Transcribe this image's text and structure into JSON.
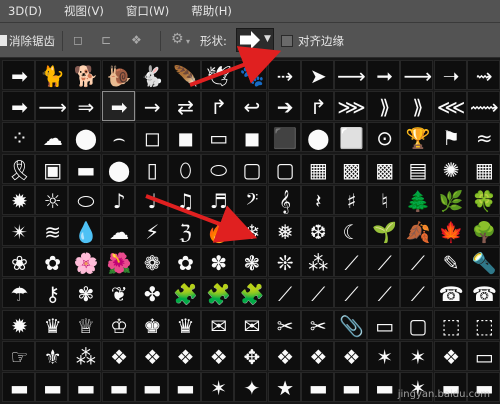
{
  "menu": {
    "items": [
      "3D(D)",
      "视图(V)",
      "窗口(W)",
      "帮助(H)"
    ]
  },
  "options": {
    "antialias_label": "消除锯齿",
    "shape_label": "形状:",
    "align_label": "对齐边缘",
    "gear_icon": "gear-icon",
    "accent": "#e02020"
  },
  "shapes": [
    [
      "➡",
      "🐈",
      "🐕",
      "🐌",
      "🐇",
      "🪶",
      "🕊",
      "🐾",
      "⇢",
      "➤",
      "⟶",
      "➞",
      "⟶",
      "➝",
      "⇝"
    ],
    [
      "➡",
      "⟶",
      "⇒",
      "➡",
      "→",
      "⇄",
      "↱",
      "↩",
      "➔",
      "↱",
      "⋙",
      "⟫",
      "⟫",
      "⋘",
      "⟿"
    ],
    [
      "⁘",
      "☁",
      "⬤",
      "⌢",
      "◻",
      "◼",
      "▭",
      "◼",
      "⬛",
      "⬤",
      "⬜",
      "⊙",
      "🏆",
      "⚑",
      "≈"
    ],
    [
      "🎗",
      "▣",
      "▬",
      "⬤",
      "▯",
      "⬯",
      "⬭",
      "▢",
      "▢",
      "▦",
      "▩",
      "▩",
      "▤",
      "✺",
      "▦"
    ],
    [
      "✹",
      "☼",
      "⬭",
      "♪",
      "♩",
      "♫",
      "♬",
      "𝄢",
      "𝄞",
      "𝄽",
      "♯",
      "♮",
      "🌲",
      "🌿",
      "🍀"
    ],
    [
      "✴",
      "≋",
      "💧",
      "☁",
      "⚡",
      "ℨ",
      "🔥",
      "❄",
      "❅",
      "❆",
      "☾",
      "🌱",
      "🍂",
      "🍁",
      "🌳"
    ],
    [
      "❀",
      "✿",
      "🌸",
      "🌺",
      "❁",
      "✿",
      "✽",
      "❃",
      "❊",
      "⁂",
      "⟋",
      "⟋",
      "⟋",
      "✎",
      "🔦"
    ],
    [
      "☂",
      "⚷",
      "✾",
      "❦",
      "✤",
      "🧩",
      "🧩",
      "🧩",
      "⟋",
      "⟋",
      "⟋",
      "⟋",
      "⟋",
      "☎",
      "☎"
    ],
    [
      "✹",
      "♛",
      "♕",
      "♔",
      "♚",
      "♛",
      "✉",
      "✉",
      "✂",
      "✂",
      "📎",
      "▭",
      "▢",
      "⬚",
      "⬚"
    ],
    [
      "☞",
      "⚜",
      "⁂",
      "❖",
      "❖",
      "❖",
      "❖",
      "✥",
      "❖",
      "❖",
      "❖",
      "✶",
      "✶",
      "❖",
      "▭"
    ],
    [
      "▬",
      "▬",
      "▬",
      "▬",
      "▬",
      "▬",
      "✶",
      "✦",
      "★",
      "▬",
      "▬",
      "▬",
      "✶",
      "▬",
      "▬"
    ]
  ],
  "watermark": "jingyan.baidu.com"
}
